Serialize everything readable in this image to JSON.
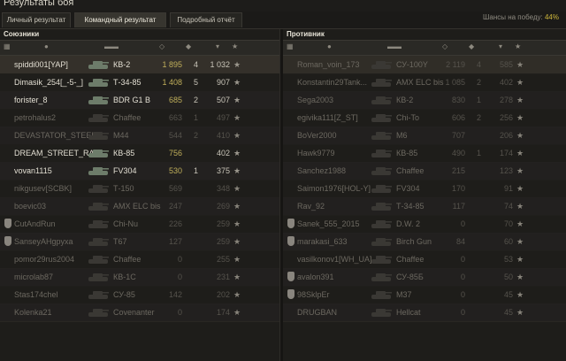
{
  "window": {
    "title": "Результаты боя"
  },
  "tabs": [
    {
      "label": "Личный результат"
    },
    {
      "label": "Командный результат",
      "active": true
    },
    {
      "label": "Подробный отчёт"
    }
  ],
  "win_chance": {
    "label": "Шансы на победу:",
    "value": "44%"
  },
  "allies": {
    "title": "Союзники",
    "rows": [
      {
        "name": "spiddi001[YAP]",
        "tank": "КВ-2",
        "damage": "1 895",
        "kills": "4",
        "xp": "1 032",
        "alive": true,
        "highlight": true
      },
      {
        "name": "Dimasik_254[_-5-_]",
        "tank": "Т-34-85",
        "damage": "1 408",
        "kills": "5",
        "xp": "907",
        "alive": true
      },
      {
        "name": "forister_8",
        "tank": "BDR G1 B",
        "damage": "685",
        "kills": "2",
        "xp": "507",
        "alive": true
      },
      {
        "name": "petrohalus2",
        "tank": "Chaffee",
        "damage": "663",
        "kills": "1",
        "xp": "497",
        "alive": false
      },
      {
        "name": "DEVASTATOR_STEEL...",
        "tank": "M44",
        "damage": "544",
        "kills": "2",
        "xp": "410",
        "alive": false
      },
      {
        "name": "DREAM_STREET_RA...",
        "tank": "КВ-85",
        "damage": "756",
        "kills": "",
        "xp": "402",
        "alive": true
      },
      {
        "name": "vovan1115",
        "tank": "FV304",
        "damage": "530",
        "kills": "1",
        "xp": "375",
        "alive": true
      },
      {
        "name": "nikgusev[SCBK]",
        "tank": "Т-150",
        "damage": "569",
        "kills": "",
        "xp": "348",
        "alive": false
      },
      {
        "name": "boevic03",
        "tank": "AMX ELC bis",
        "damage": "247",
        "kills": "",
        "xp": "269",
        "alive": false
      },
      {
        "name": "CutAndRun",
        "tank": "Chi-Nu",
        "damage": "226",
        "kills": "",
        "xp": "259",
        "alive": false,
        "badge": true
      },
      {
        "name": "SanseyAHgpyxa",
        "tank": "T67",
        "damage": "127",
        "kills": "",
        "xp": "259",
        "alive": false,
        "badge": true
      },
      {
        "name": "pomor29rus2004",
        "tank": "Chaffee",
        "damage": "0",
        "kills": "",
        "xp": "255",
        "alive": false
      },
      {
        "name": "microlab87",
        "tank": "КВ-1С",
        "damage": "0",
        "kills": "",
        "xp": "231",
        "alive": false
      },
      {
        "name": "Stas174chel",
        "tank": "СУ-85",
        "damage": "142",
        "kills": "",
        "xp": "202",
        "alive": false
      },
      {
        "name": "Kolenka21",
        "tank": "Covenanter",
        "damage": "0",
        "kills": "",
        "xp": "174",
        "alive": false
      }
    ]
  },
  "enemies": {
    "title": "Противник",
    "rows": [
      {
        "name": "Roman_voin_173",
        "tank": "СУ-100Y",
        "damage": "2 119",
        "kills": "4",
        "xp": "585",
        "alive": false,
        "highlight": true
      },
      {
        "name": "Konstantin29Tank...",
        "tank": "AMX ELC bis",
        "damage": "1 085",
        "kills": "2",
        "xp": "402",
        "alive": false
      },
      {
        "name": "Sega2003",
        "tank": "КВ-2",
        "damage": "830",
        "kills": "1",
        "xp": "278",
        "alive": false
      },
      {
        "name": "egivika111[Z_ST]",
        "tank": "Chi-To",
        "damage": "606",
        "kills": "2",
        "xp": "256",
        "alive": false
      },
      {
        "name": "BoVer2000",
        "tank": "M6",
        "damage": "707",
        "kills": "",
        "xp": "206",
        "alive": false
      },
      {
        "name": "Hawk9779",
        "tank": "КВ-85",
        "damage": "490",
        "kills": "1",
        "xp": "174",
        "alive": false
      },
      {
        "name": "Sanchez1988",
        "tank": "Chaffee",
        "damage": "215",
        "kills": "",
        "xp": "123",
        "alive": false
      },
      {
        "name": "Saimon1976[HOL-Y]",
        "tank": "FV304",
        "damage": "170",
        "kills": "",
        "xp": "91",
        "alive": false
      },
      {
        "name": "Rav_92",
        "tank": "Т-34-85",
        "damage": "117",
        "kills": "",
        "xp": "74",
        "alive": false
      },
      {
        "name": "Sanek_555_2015",
        "tank": "D.W. 2",
        "damage": "0",
        "kills": "",
        "xp": "70",
        "alive": false,
        "badge": true
      },
      {
        "name": "marakasi_633",
        "tank": "Birch Gun",
        "damage": "84",
        "kills": "",
        "xp": "60",
        "alive": false,
        "badge": true
      },
      {
        "name": "vasilkonov1[WH_UA]",
        "tank": "Chaffee",
        "damage": "0",
        "kills": "",
        "xp": "53",
        "alive": false
      },
      {
        "name": "avalon391",
        "tank": "СУ-85Б",
        "damage": "0",
        "kills": "",
        "xp": "50",
        "alive": false,
        "badge": true
      },
      {
        "name": "98SklpEr",
        "tank": "M37",
        "damage": "0",
        "kills": "",
        "xp": "45",
        "alive": false,
        "badge": true
      },
      {
        "name": "DRUGBAN",
        "tank": "Hellcat",
        "damage": "0",
        "kills": "",
        "xp": "45",
        "alive": false
      }
    ]
  },
  "icons": {
    "header": [
      "squad-icon",
      "player-icon",
      "tank-icon",
      "damage-icon",
      "kills-icon",
      "xp-sort-icon"
    ],
    "row": [
      "star-icon",
      "tank-silhouette-icon"
    ]
  }
}
